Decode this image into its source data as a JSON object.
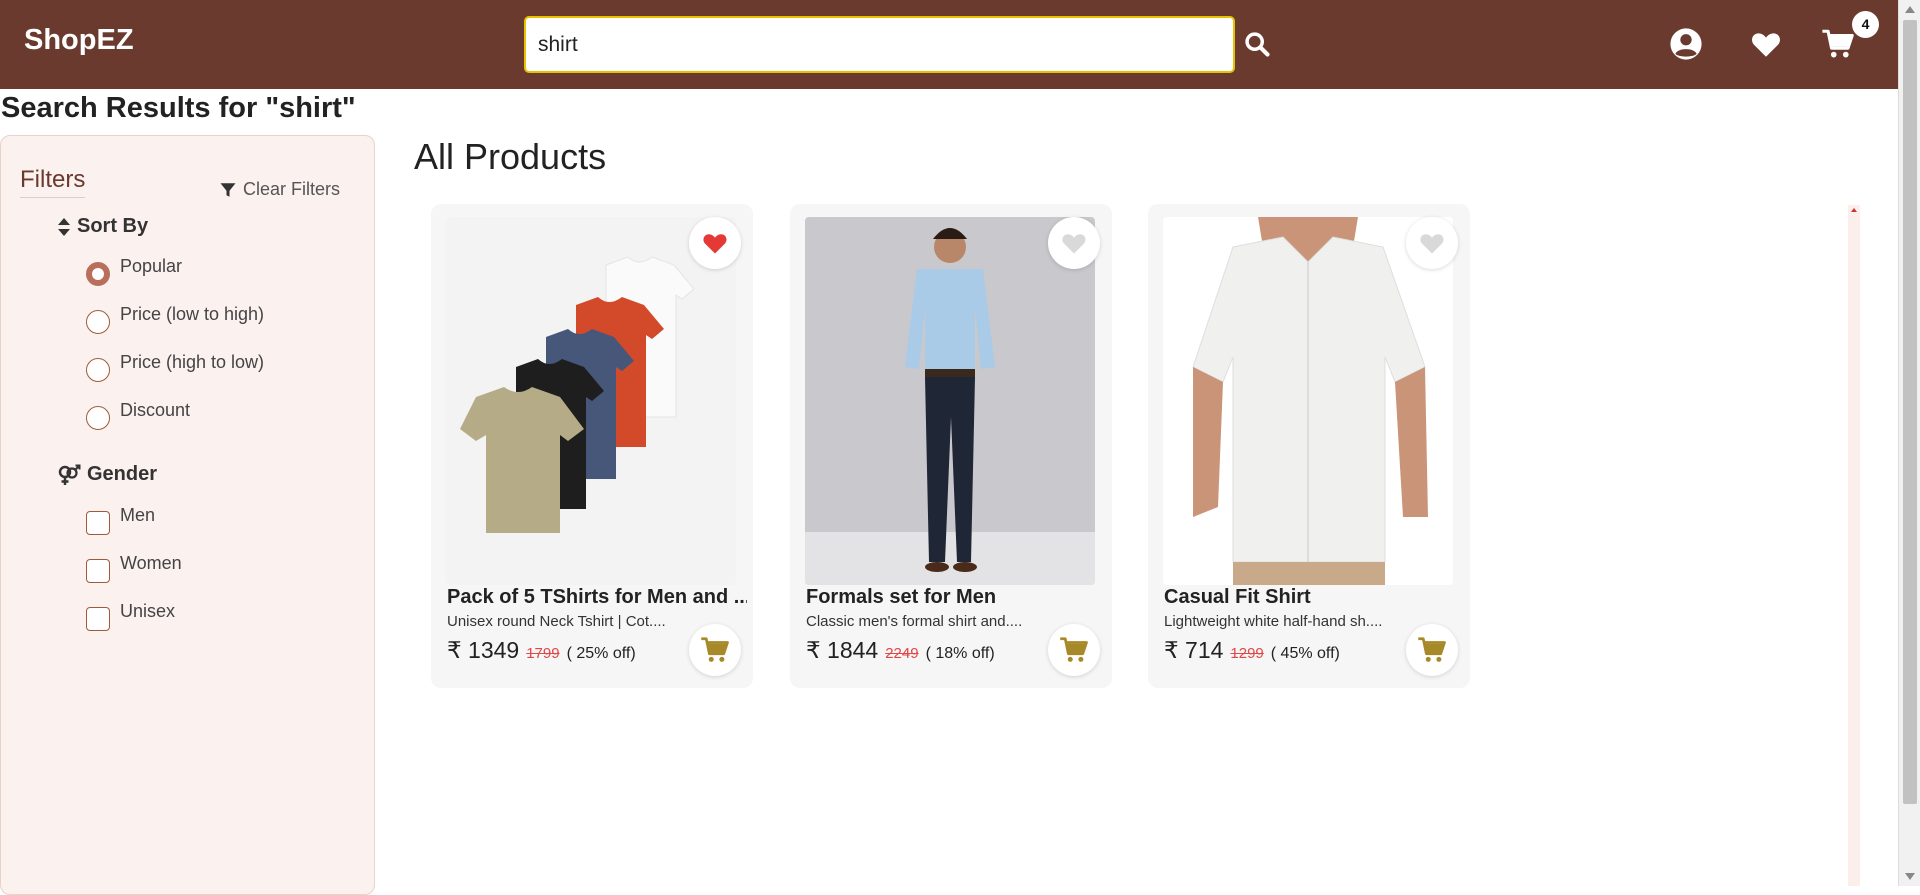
{
  "header": {
    "logo": "ShopEZ",
    "search_value": "shirt",
    "cart_count": "4",
    "icons": [
      "search-icon",
      "user-circle-icon",
      "heart-icon",
      "cart-icon"
    ]
  },
  "page": {
    "search_title": "Search Results for \"shirt\"",
    "main_title": "All Products"
  },
  "filters": {
    "title": "Filters",
    "clear_label": "Clear Filters",
    "sort": {
      "title": "Sort By",
      "options": [
        "Popular",
        "Price (low to high)",
        "Price (high to low)",
        "Discount"
      ],
      "selected": "Popular"
    },
    "gender": {
      "title": "Gender",
      "options": [
        "Men",
        "Women",
        "Unisex"
      ]
    }
  },
  "products": [
    {
      "name": "Pack of 5 TShirts for Men and ...",
      "desc": "Unisex round Neck Tshirt | Cot....",
      "price": "₹ 1349",
      "mrp": "1799",
      "discount": "( 25% off)",
      "favorited": true
    },
    {
      "name": "Formals set for Men",
      "desc": "Classic men's formal shirt and....",
      "price": "₹ 1844",
      "mrp": "2249",
      "discount": "( 18% off)",
      "favorited": false
    },
    {
      "name": "Casual Fit Shirt",
      "desc": "Lightweight white half-hand sh....",
      "price": "₹ 714",
      "mrp": "1299",
      "discount": "( 45% off)",
      "favorited": false
    }
  ],
  "colors": {
    "brand": "#6b3a2e",
    "cart_icon": "#a8892a",
    "fav_active": "#e53935",
    "fav_inactive": "#d9d9d9"
  }
}
